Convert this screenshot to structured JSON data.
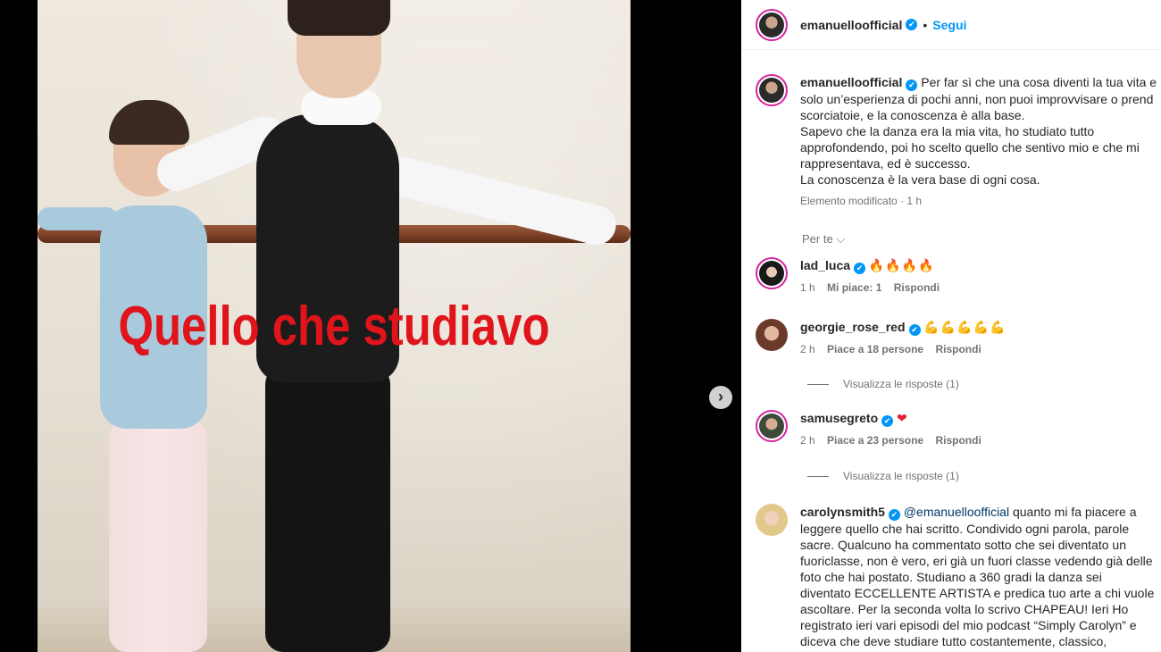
{
  "media": {
    "photo_caption": "Quello che studiavo",
    "next_icon": "chevron-right-icon"
  },
  "post_header": {
    "username": "emanuelloofficial",
    "verified": "✔",
    "separator": "•",
    "follow_label": "Segui"
  },
  "caption": {
    "username": "emanuelloofficial",
    "lines": [
      "Per far sì che una cosa diventi la tua vita e",
      "solo un’esperienza di pochi anni, non puoi improvvisare o prend",
      "scorciatoie, e la conoscenza è alla base.",
      "Sapevo che la danza era la mia vita, ho studiato tutto",
      "approfondendo, poi ho scelto quello che sentivo mio e che mi",
      "rappresentava, ed è successo.",
      "La conoscenza è la vera base di ogni cosa."
    ],
    "meta": "Elemento modificato · 1 h",
    "see_translation": "Per te"
  },
  "comments": [
    {
      "username": "lad_luca",
      "text": "🔥🔥🔥🔥",
      "time": "1 h",
      "likes": "Mi piace: 1",
      "reply": "Rispondi"
    },
    {
      "username": "georgie_rose_red",
      "text": "💪💪💪💪💪",
      "time": "2 h",
      "likes": "Piace a 18 persone",
      "reply": "Rispondi",
      "view_replies": "Visualizza le risposte (1)"
    },
    {
      "username": "samusegreto",
      "text": "❤",
      "time": "2 h",
      "likes": "Piace a 23 persone",
      "reply": "Rispondi",
      "view_replies": "Visualizza le risposte (1)"
    },
    {
      "username": "carolynsmith5",
      "mention": "@emanuelloofficial",
      "lines": [
        "quanto mi fa piacere a",
        "leggere quello che hai scritto. Condivido ogni parola, parole",
        "sacre. Qualcuno ha commentato sotto che sei diventato un",
        "fuoriclasse, non è vero, eri già un fuori classe vedendo già delle",
        "foto che hai postato. Studiano a 360 gradi la danza sei",
        "diventato ECCELLENTE ARTISTA e predica tuo arte a chi vuole",
        "ascoltare. Per la seconda volta lo scrivo CHAPEAU! Ieri Ho",
        "registrato ieri vari episodi del mio podcast “Simply Carolyn” e",
        "diceva che deve studiare tutto costantemente, classico,"
      ]
    }
  ],
  "colors": {
    "accent": "#0095f6",
    "caption_red": "#e0141b",
    "muted": "#737373"
  }
}
